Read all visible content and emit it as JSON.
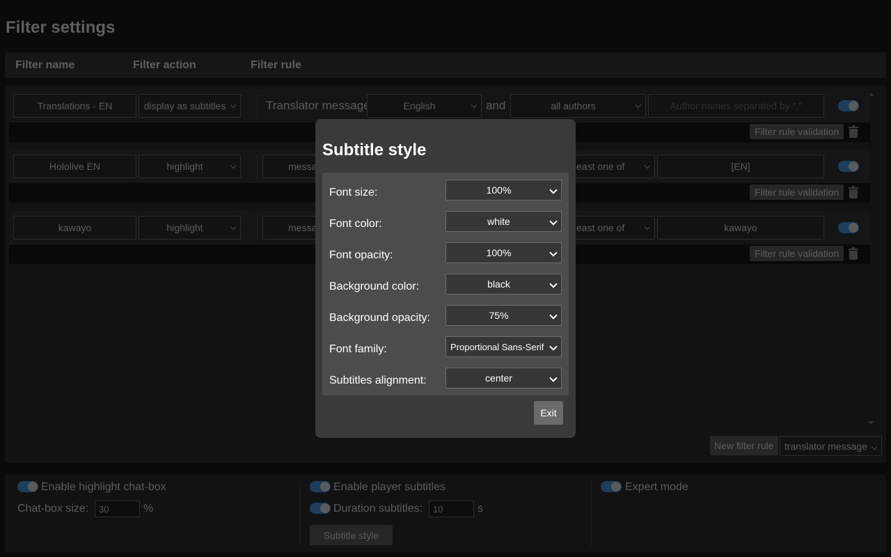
{
  "page": {
    "title": "Filter settings"
  },
  "header": {
    "filter_name": "Filter name",
    "filter_action": "Filter action",
    "filter_rule": "Filter rule"
  },
  "rules": [
    {
      "name": "Translations - EN",
      "action": "display as subtitles",
      "type_label": "Translator message",
      "language": "English",
      "joiner": "and",
      "authors": "all authors",
      "authors_placeholder": "Author names separated by \",\"",
      "enabled": true,
      "validation": "Filter rule validation"
    },
    {
      "name": "Hololive EN",
      "action": "highlight",
      "type_label": "messa",
      "condition": "east one of",
      "value": "[EN]",
      "enabled": true,
      "validation": "Filter rule validation"
    },
    {
      "name": "kawayo",
      "action": "highlight",
      "type_label": "messa",
      "condition": "east one of",
      "value": "kawayo",
      "enabled": true,
      "validation": "Filter rule validation"
    }
  ],
  "panel_footer": {
    "new_rule": "New filter rule",
    "new_rule_type": "translator message"
  },
  "options": {
    "highlight_chatbox": "Enable highlight chat-box",
    "chatbox_size_label": "Chat-box size:",
    "chatbox_size_value": "30",
    "chatbox_size_unit": "%",
    "player_subtitles": "Enable player subtitles",
    "duration_label": "Duration subtitles:",
    "duration_value": "10",
    "duration_unit": "s",
    "subtitle_style_button": "Subtitle style",
    "expert_mode": "Expert mode"
  },
  "modal": {
    "title": "Subtitle style",
    "rows": [
      {
        "label": "Font size:",
        "value": "100%"
      },
      {
        "label": "Font color:",
        "value": "white"
      },
      {
        "label": "Font opacity:",
        "value": "100%"
      },
      {
        "label": "Background color:",
        "value": "black"
      },
      {
        "label": "Background opacity:",
        "value": "75%"
      },
      {
        "label": "Font family:",
        "value": "Proportional Sans-Serif"
      },
      {
        "label": "Subtitles alignment:",
        "value": "center"
      }
    ],
    "exit": "Exit"
  },
  "colors": {
    "toggle_on": "#1c3e5c",
    "modal_bg": "#3a3a3a",
    "modal_body": "#4c4c4c"
  },
  "icons": {
    "delete": "trash-icon",
    "dropdown": "chevron-down-icon"
  }
}
